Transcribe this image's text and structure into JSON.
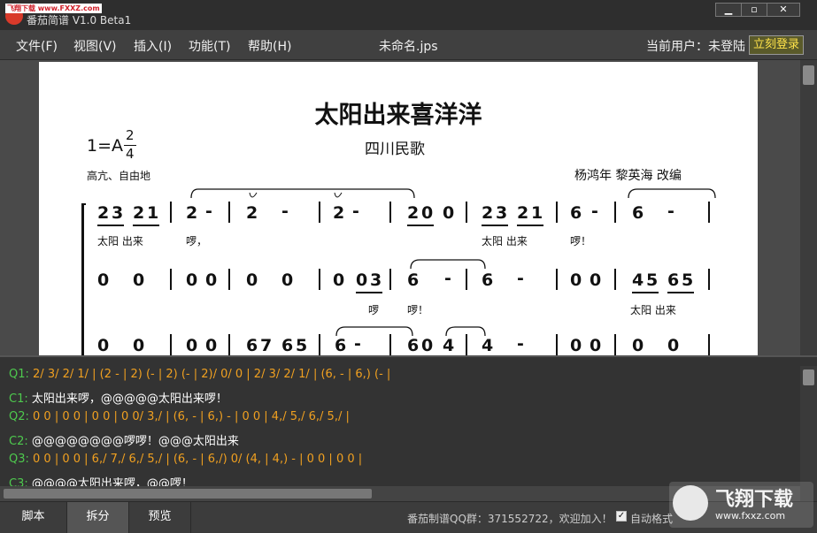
{
  "titlebar": {
    "title": "番茄简谱 V1.0 Beta1",
    "watermark": "飞翔下载 www.FXXZ.com"
  },
  "menu": [
    "文件(F)",
    "视图(V)",
    "插入(I)",
    "功能(T)",
    "帮助(H)"
  ],
  "filename": "未命名.jps",
  "user": {
    "label": "当前用户：未登陆",
    "login": "立刻登录"
  },
  "score": {
    "title": "太阳出来喜洋洋",
    "key": "1=A",
    "time_top": "2",
    "time_bottom": "4",
    "subtitle": "四川民歌",
    "tempo": "高亢、自由地",
    "arranger": "杨鸿年 黎英海 改编"
  },
  "code_lines": [
    {
      "label": "Q1:",
      "text": "2/ 3/ 2/ 1/ | (2 - | 2) (- | 2) (- | 2)/ 0/ 0 | 2/ 3/ 2/ 1/ | (6, - | 6,) (- |",
      "type": "q"
    },
    {
      "label": "C1:",
      "text": "太阳出来啰，@@@@@太阳出来啰！",
      "type": "c"
    },
    {
      "label": "Q2:",
      "text": "0 0 | 0 0 | 0 0 | 0 0/ 3,/ | (6, - | 6,) - | 0 0 | 4,/ 5,/ 6,/ 5,/ |",
      "type": "q"
    },
    {
      "label": "C2:",
      "text": "@@@@@@@@啰啰！@@@太阳出来",
      "type": "c"
    },
    {
      "label": "Q3:",
      "text": "0 0 | 0 0 | 6,/ 7,/ 6,/ 5,/ | (6, - | 6,/) 0/ (4, | 4,) - | 0 0 | 0 0 |",
      "type": "q"
    },
    {
      "label": "C3:",
      "text": "@@@@太阳出来啰，@@啰！",
      "type": "c"
    }
  ],
  "tabs": [
    "脚本",
    "拆分",
    "预览"
  ],
  "status": {
    "qq": "番茄制谱QQ群：371552722，欢迎加入！",
    "auto": "自动格式"
  },
  "corner_logo": {
    "name": "飞翔下载",
    "url": "www.fxxz.com"
  }
}
